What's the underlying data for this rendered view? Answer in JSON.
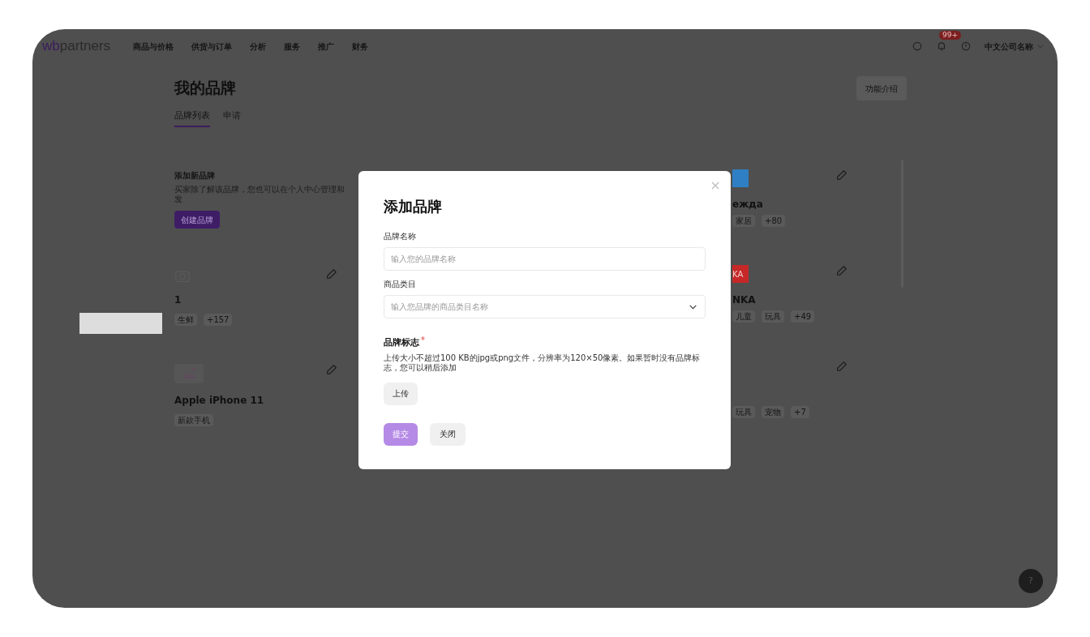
{
  "header": {
    "logo": {
      "accent": "wb",
      "rest": "partners"
    },
    "nav": [
      "商品与价格",
      "供货与订单",
      "分析",
      "服务",
      "推广",
      "财务"
    ],
    "notifications_badge": "99+",
    "account": "中文公司名称"
  },
  "page": {
    "title": "我的品牌",
    "help_button": "功能介绍",
    "tabs": [
      {
        "label": "品牌列表",
        "selected": true
      },
      {
        "label": "申请",
        "selected": false
      }
    ],
    "add_card": {
      "title": "添加新品牌",
      "description": "买家除了解该品牌，您也可以在个人中心管理和发",
      "button": "创建品牌"
    },
    "brands_left": [
      {
        "kind": "camera",
        "name": "1",
        "tags": [
          "生鲜",
          "+157"
        ]
      },
      {
        "kind": "picture",
        "name": "Apple iPhone 11",
        "tags": [
          "新款手机"
        ]
      }
    ],
    "brands_right": [
      {
        "color": "#2f7fc4",
        "name": "ежда",
        "tags": [
          "家居",
          "+80"
        ]
      },
      {
        "color": "#c62828",
        "logo_text": "KA",
        "name": "NKA",
        "tags": [
          "儿童",
          "玩具",
          "+49"
        ]
      },
      {
        "tags": [
          "玩具",
          "宠物",
          "+7"
        ]
      }
    ]
  },
  "modal": {
    "title": "添加品牌",
    "fields": [
      {
        "kind": "text",
        "label": "品牌名称",
        "placeholder": "输入您的品牌名称"
      },
      {
        "kind": "select",
        "label": "商品类目",
        "placeholder": "输入您品牌的商品类目名称"
      }
    ],
    "logo_section": {
      "label": "品牌标志",
      "required_mark": "*",
      "hint": "上传大小不超过100 KB的jpg或png文件，分辨率为120×50像素。如果暂时没有品牌标志，您可以稍后添加",
      "upload": "上传"
    },
    "submit": {
      "label": "提交",
      "disabled": true
    },
    "close": "关闭"
  },
  "help": "?"
}
